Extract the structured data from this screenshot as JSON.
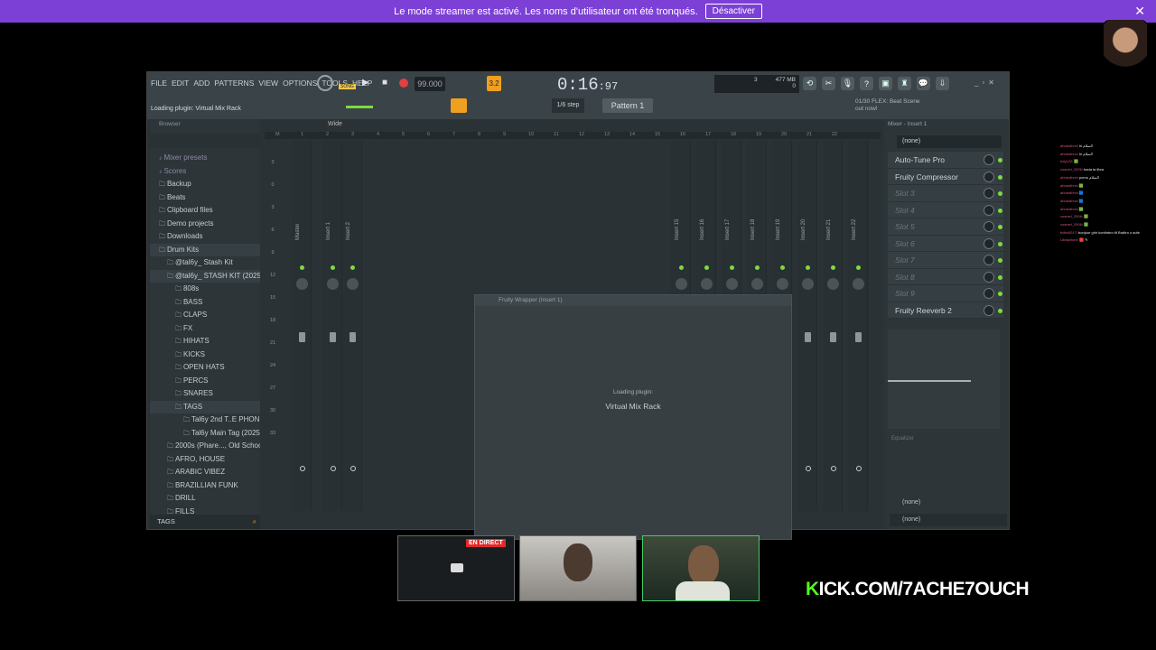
{
  "banner": {
    "message": "Le mode streamer est activé. Les noms d'utilisateur ont été tronqués.",
    "button": "Désactiver",
    "close": "✕"
  },
  "chat": [
    {
      "user": "ahmedhmi",
      "text": ": ‏hi ‏السلام‏"
    },
    {
      "user": "ahmedhmi",
      "text": ": ‏hi ‏السلام‏"
    },
    {
      "user": "edy122",
      "text": ": 🟩"
    },
    {
      "user": "cosmel_2006",
      "text": ": bada ta libra"
    },
    {
      "user": "ahmedhmi",
      "text": ": pomo ‏السلام‏"
    },
    {
      "user": "ahmedhmi",
      "text": ": 🟩"
    },
    {
      "user": "ahmedhmi",
      "text": ": 🟦"
    },
    {
      "user": "ahmedhmi",
      "text": ": 🟦"
    },
    {
      "user": "ahmedhmi",
      "text": ": 🟩"
    },
    {
      "user": "cosmel_2006",
      "text": ": 🟩"
    },
    {
      "user": "cosmel_2006",
      "text": ": 🟩"
    },
    {
      "user": "bdbn0017",
      "text": ": bonjour ghir kontinbro tlt Braltro o sufe"
    },
    {
      "user": "Ukraipfoxx",
      "text": ": 🟥 ✎"
    }
  ],
  "fl": {
    "menu": [
      "FILE",
      "EDIT",
      "ADD",
      "PATTERNS",
      "VIEW",
      "OPTIONS",
      "TOOLS",
      "HELP"
    ],
    "hint": "Loading plugin: Virtual Mix Rack",
    "tempo": "99.000",
    "song_label": "SONG",
    "clock_main": "0:16",
    "clock_sub": ":97",
    "mem": "477 MB",
    "mem_sub": "0",
    "bars": "3",
    "step": "1/6 step",
    "pattern": "Pattern 1",
    "scene_title": "01/30  FLEX: Beat Scene",
    "scene_sub": "out now!",
    "mixer_mode": "Wide",
    "browser": {
      "header": "Browser",
      "items": [
        {
          "label": "Mixer presets",
          "indent": 0,
          "dim": true
        },
        {
          "label": "Scores",
          "indent": 0,
          "dim": true
        },
        {
          "label": "Backup",
          "indent": 0
        },
        {
          "label": "Beats",
          "indent": 0
        },
        {
          "label": "Clipboard files",
          "indent": 0
        },
        {
          "label": "Demo projects",
          "indent": 0
        },
        {
          "label": "Downloads",
          "indent": 0
        },
        {
          "label": "Drum Kits",
          "indent": 0,
          "sel": true
        },
        {
          "label": "@tal6y_ Stash Kit",
          "indent": 1
        },
        {
          "label": "@tal6y_ STASH KIT (2025)",
          "indent": 1,
          "sel": true
        },
        {
          "label": "808s",
          "indent": 2
        },
        {
          "label": "BASS",
          "indent": 2
        },
        {
          "label": "CLAPS",
          "indent": 2
        },
        {
          "label": "FX",
          "indent": 2
        },
        {
          "label": "HIHATS",
          "indent": 2
        },
        {
          "label": "KICKS",
          "indent": 2
        },
        {
          "label": "OPEN HATS",
          "indent": 2
        },
        {
          "label": "PERCS",
          "indent": 2
        },
        {
          "label": "SNARES",
          "indent": 2
        },
        {
          "label": "TAGS",
          "indent": 2,
          "sel": true
        },
        {
          "label": "Tal6y 2nd T..E PHONE!)",
          "indent": 3
        },
        {
          "label": "Tal6y Main Tag (2025)",
          "indent": 3
        },
        {
          "label": "2000s (Phare..., Old School)",
          "indent": 1
        },
        {
          "label": "AFRO, HOUSE",
          "indent": 1
        },
        {
          "label": "ARABIC VIBEZ",
          "indent": 1
        },
        {
          "label": "BRAZILLIAN FUNK",
          "indent": 1
        },
        {
          "label": "DRILL",
          "indent": 1
        },
        {
          "label": "FILLS",
          "indent": 1
        }
      ],
      "tags_label": "TAGS"
    },
    "tracks_left": [
      "Master",
      "Insert 1",
      "Insert 2"
    ],
    "tracks_right": [
      "Insert 15",
      "Insert 16",
      "Insert 17",
      "Insert 18",
      "Insert 19",
      "Insert 20",
      "Insert 21",
      "Insert 22"
    ],
    "ruler_left": [
      "M",
      "1",
      "2",
      "3",
      "4",
      "5",
      "6",
      "7",
      "8",
      "9",
      "10",
      "11",
      "12",
      "13",
      "14",
      "15",
      "16",
      "17",
      "18",
      "19",
      "20",
      "21",
      "22"
    ],
    "db_scale": [
      "3",
      "0",
      "3",
      "6",
      "9",
      "12",
      "15",
      "18",
      "21",
      "24",
      "27",
      "30",
      "33"
    ],
    "wrapper": {
      "title": "Fruity Wrapper (Insert 1)",
      "loading": "Loading plugin:",
      "plugin": "Virtual Mix Rack"
    },
    "insert": {
      "title": "Mixer - Insert 1",
      "preset": "(none)",
      "slots": [
        {
          "label": "Auto-Tune Pro",
          "empty": false
        },
        {
          "label": "Fruity Compressor",
          "empty": false
        },
        {
          "label": "Slot 3",
          "empty": true
        },
        {
          "label": "Slot 4",
          "empty": true
        },
        {
          "label": "Slot 5",
          "empty": true
        },
        {
          "label": "Slot 6",
          "empty": true
        },
        {
          "label": "Slot 7",
          "empty": true
        },
        {
          "label": "Slot 8",
          "empty": true
        },
        {
          "label": "Slot 9",
          "empty": true
        },
        {
          "label": "Fruity Reeverb 2",
          "empty": false
        }
      ],
      "eq_label": "Equalizer",
      "route_in": "(none)",
      "route_out": "(none)"
    }
  },
  "stream": {
    "live_badge": "EN DIRECT",
    "brand_k": "K",
    "brand_rest": "ICK.COM/7ACHE7OUCH"
  }
}
